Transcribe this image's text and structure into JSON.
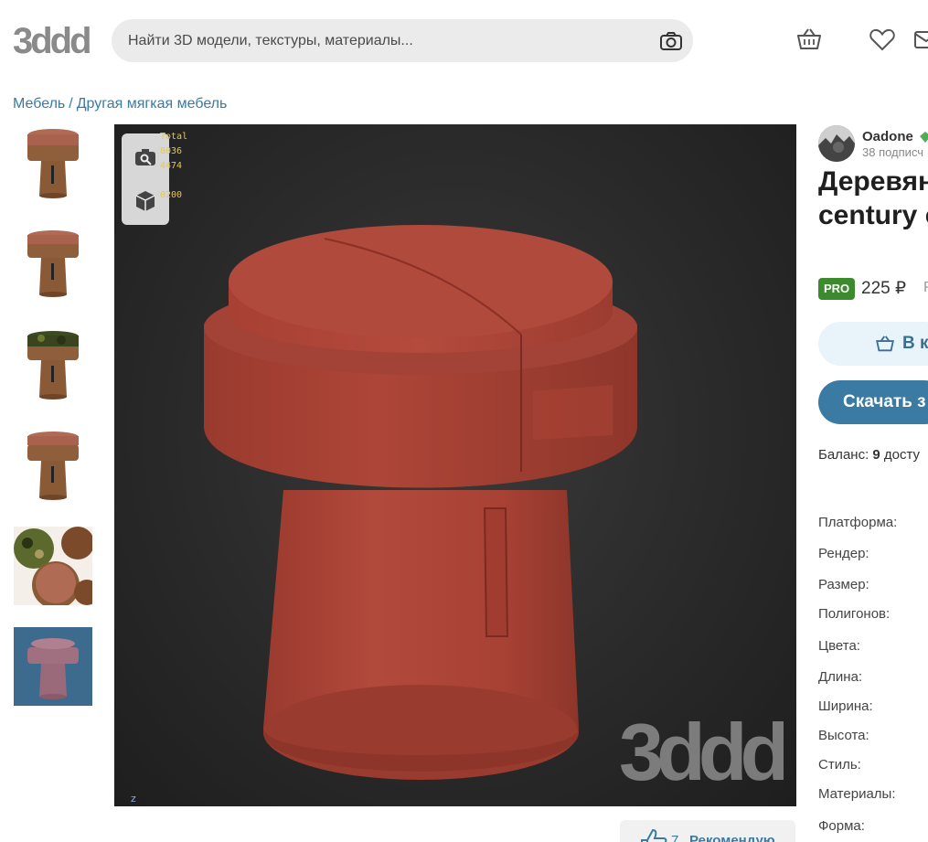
{
  "header": {
    "logo_text": "3ddd",
    "search_placeholder": "Найти 3D модели, текстуры, материалы...",
    "icons": [
      "camera-icon",
      "basket-icon",
      "heart-icon",
      "mail-icon"
    ]
  },
  "breadcrumb": {
    "items": [
      "Мебель",
      "Другая мягкая мебель"
    ],
    "separator": "/"
  },
  "viewer": {
    "stats": [
      "Total",
      "8036",
      "4474",
      "0200"
    ],
    "watermark": "3ddd",
    "axis_label": "z",
    "tools": [
      "camera-icon",
      "cube-icon"
    ]
  },
  "thumbnails": [
    {
      "name": "stool-fabric-top-1"
    },
    {
      "name": "stool-fabric-top-2"
    },
    {
      "name": "stool-camo-top"
    },
    {
      "name": "stool-fabric-top-3"
    },
    {
      "name": "stools-group"
    },
    {
      "name": "stool-wireframe-blue"
    }
  ],
  "author": {
    "name": "Oadone",
    "subscribers": "38 подписч"
  },
  "product": {
    "title_line1": "Деревян",
    "title_line2": "century c",
    "pro_label": "PRO",
    "price": "225 ₽",
    "price_extra": "Р",
    "cart_label": "В к",
    "download_label": "Скачать з",
    "balance_label": "Баланс:",
    "balance_value": "9",
    "balance_suffix": "досту"
  },
  "specs": [
    "Платформа:",
    "Рендер:",
    "Размер:",
    "Полигонов:",
    "Цвета:",
    "Длина:",
    "Ширина:",
    "Высота:",
    "Стиль:",
    "Материалы:",
    "Форма:"
  ],
  "recommend": {
    "count": "7",
    "label": "Рекомендую"
  },
  "colors": {
    "accent": "#3a7aa3",
    "pro": "#3c8a2e",
    "model": "#a84235"
  }
}
